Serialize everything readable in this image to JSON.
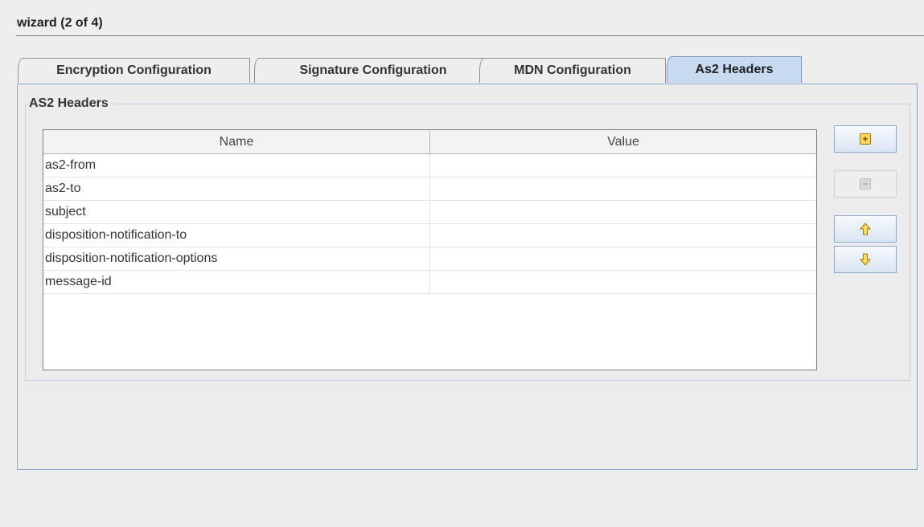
{
  "window": {
    "title": "wizard (2 of 4)"
  },
  "tabs": [
    {
      "label": "Encryption Configuration",
      "active": false
    },
    {
      "label": "Signature Configuration",
      "active": false
    },
    {
      "label": "MDN Configuration",
      "active": false
    },
    {
      "label": "As2 Headers",
      "active": true
    }
  ],
  "group": {
    "title": "AS2 Headers"
  },
  "table": {
    "columns": [
      "Name",
      "Value"
    ],
    "rows": [
      {
        "name": "as2-from",
        "value": ""
      },
      {
        "name": "as2-to",
        "value": ""
      },
      {
        "name": "subject",
        "value": ""
      },
      {
        "name": "disposition-notification-to",
        "value": ""
      },
      {
        "name": "disposition-notification-options",
        "value": ""
      },
      {
        "name": "message-id",
        "value": ""
      }
    ]
  },
  "buttons": {
    "add": {
      "icon": "plus-icon",
      "glyph": "+",
      "enabled": true
    },
    "remove": {
      "icon": "minus-icon",
      "glyph": "−",
      "enabled": false
    },
    "move_up": {
      "icon": "arrow-up-icon",
      "enabled": true
    },
    "move_down": {
      "icon": "arrow-down-icon",
      "enabled": true
    }
  },
  "colors": {
    "active_tab": "#c8daf0",
    "icon_fill": "#ffd85a",
    "border_blue": "#8aa2c4"
  }
}
